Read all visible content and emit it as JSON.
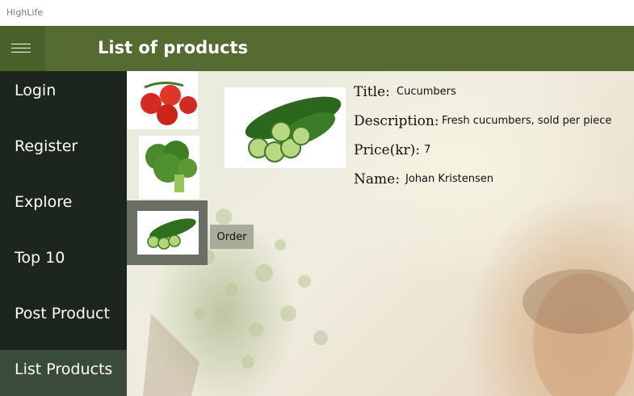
{
  "window": {
    "title": "HighLife"
  },
  "header": {
    "title": "List of products",
    "menu_icon": "hamburger-icon"
  },
  "sidebar": {
    "items": [
      {
        "label": "Login",
        "active": false
      },
      {
        "label": "Register",
        "active": false
      },
      {
        "label": "Explore",
        "active": false
      },
      {
        "label": "Top 10",
        "active": false
      },
      {
        "label": "Post Product",
        "active": false
      },
      {
        "label": "List Products",
        "active": true
      }
    ]
  },
  "products": [
    {
      "image": "tomatoes-image"
    },
    {
      "image": "broccoli-image"
    },
    {
      "image": "cucumbers-image",
      "selected": true
    }
  ],
  "order_button": {
    "label": "Order"
  },
  "details": {
    "title_label": "Title:",
    "title_value": "Cucumbers",
    "description_label": "Description:",
    "description_value": "Fresh cucumbers, sold per piece",
    "price_label": "Price(kr):",
    "price_value": "7",
    "name_label": "Name:",
    "name_value": "Johan Kristensen"
  },
  "colors": {
    "header": "#566b31",
    "sidebar": "#1c261e",
    "active_item": "#3a4a3b"
  }
}
